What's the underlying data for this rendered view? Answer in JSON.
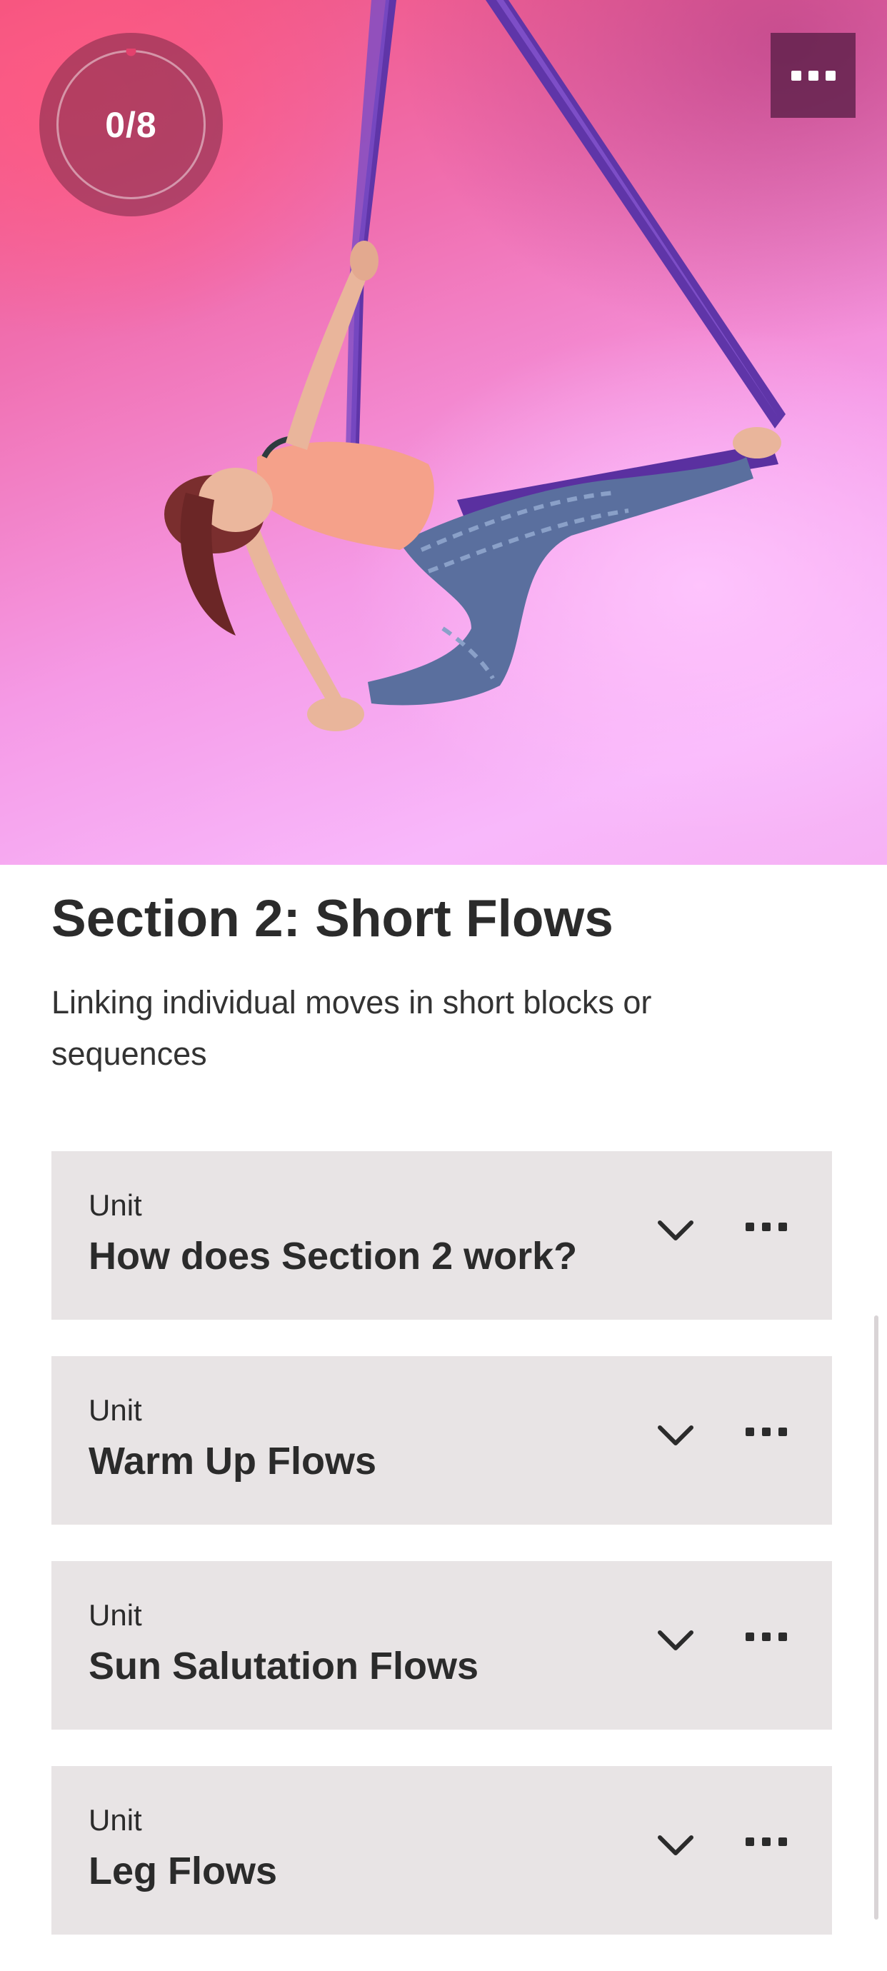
{
  "hero": {
    "image_subject": "aerial-yoga-photo",
    "progress_text": "0/8",
    "progress_fraction": 0,
    "menu_icon": "more-horizontal-icon"
  },
  "section": {
    "title": "Section 2: Short Flows",
    "description": "Linking individual moves in short blocks or sequences"
  },
  "units": [
    {
      "kicker": "Unit",
      "title": "How does Section 2 work?"
    },
    {
      "kicker": "Unit",
      "title": "Warm Up Flows"
    },
    {
      "kicker": "Unit",
      "title": "Sun Salutation Flows"
    },
    {
      "kicker": "Unit",
      "title": "Leg Flows"
    }
  ],
  "colors": {
    "card_background": "#e8e4e5",
    "text": "#2b2b2b",
    "hero_pink": "#f06fb0",
    "silk_purple": "#6a3fb5"
  }
}
